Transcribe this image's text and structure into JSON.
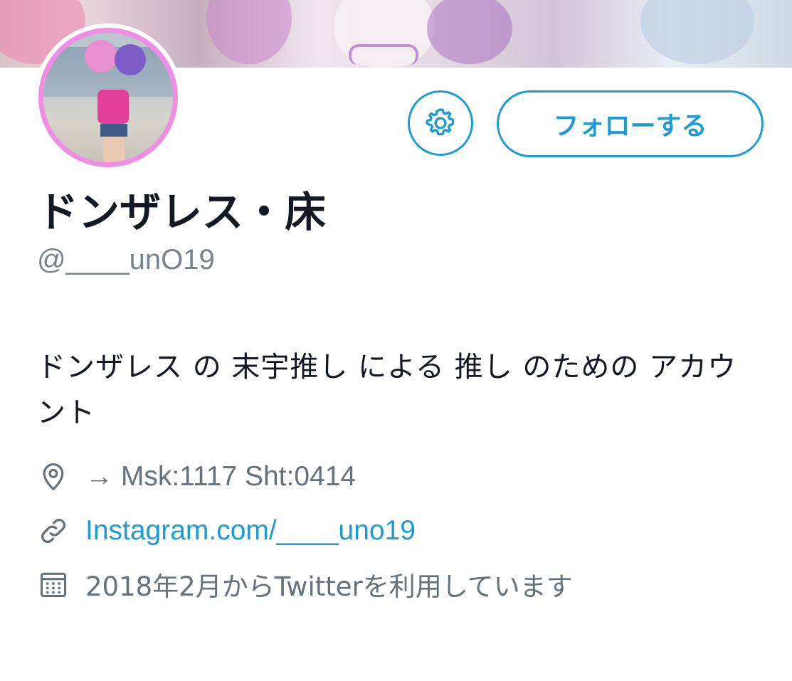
{
  "profile": {
    "display_name": "ドンザレス・床",
    "handle": "@____unO19",
    "bio": "ドンザレス の 末宇推し による 推し のための アカウント",
    "location": "→ Msk:1117 Sht:0414",
    "website": "Instagram.com/____uno19",
    "joined": "2018年2月からTwitterを利用しています"
  },
  "actions": {
    "follow_label": "フォローする",
    "settings_icon": "gear-icon"
  },
  "icons": {
    "location": "map-pin-icon",
    "website": "link-icon",
    "joined": "calendar-icon"
  },
  "colors": {
    "accent": "#1e9bd7",
    "avatar_ring": "#ee8fe3",
    "text_primary": "#141823",
    "text_secondary": "#66717a"
  }
}
